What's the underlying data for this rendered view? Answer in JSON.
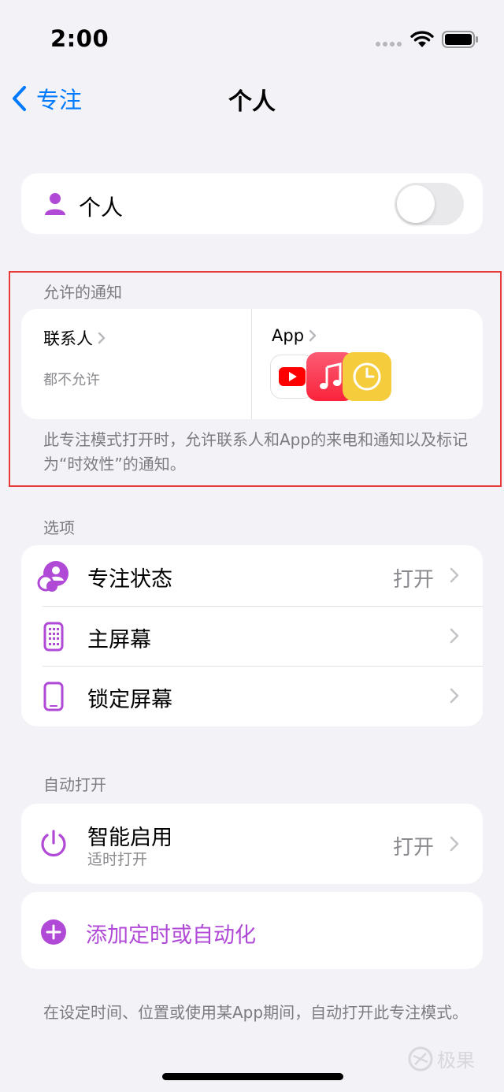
{
  "status_bar": {
    "time": "2:00"
  },
  "nav": {
    "back_label": "专注",
    "title": "个人"
  },
  "toggle_row": {
    "label": "个人",
    "on": false
  },
  "allowed": {
    "header": "允许的通知",
    "contacts": {
      "title": "联系人",
      "subtitle": "都不允许"
    },
    "apps": {
      "title": "App",
      "icons": [
        "youtube-icon",
        "music-icon",
        "clock-icon"
      ]
    },
    "footnote": "此专注模式打开时，允许联系人和App的来电和通知以及标记为“时效性”的通知。"
  },
  "options": {
    "header": "选项",
    "items": [
      {
        "label": "专注状态",
        "value": "打开",
        "icon": "focus-status-icon"
      },
      {
        "label": "主屏幕",
        "value": "",
        "icon": "home-screen-icon"
      },
      {
        "label": "锁定屏幕",
        "value": "",
        "icon": "lock-screen-icon"
      }
    ]
  },
  "auto_on": {
    "header": "自动打开",
    "smart": {
      "label": "智能启用",
      "sublabel": "适时打开",
      "value": "打开"
    },
    "add_label": "添加定时或自动化",
    "footnote": "在设定时间、位置或使用某App期间，自动打开此专注模式。"
  },
  "watermark": "极果",
  "colors": {
    "accent": "#007aff",
    "purple": "#b04ad6",
    "highlight_box": "#e63a36"
  }
}
